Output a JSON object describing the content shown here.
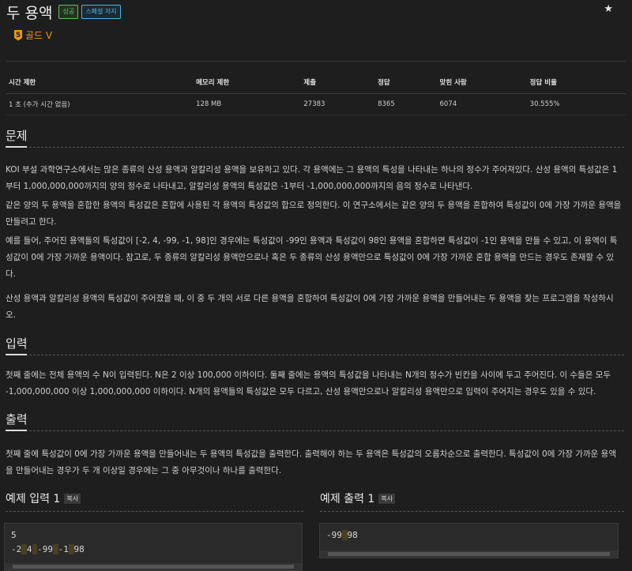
{
  "problem": {
    "title": "두 용액",
    "badges": {
      "success": "성공",
      "special": "스페셜 저지"
    },
    "tier": {
      "number": "5",
      "label": "골드 V",
      "color": "#ec9a00"
    }
  },
  "stats": {
    "headers": [
      "시간 제한",
      "메모리 제한",
      "제출",
      "정답",
      "맞힌 사람",
      "정답 비율"
    ],
    "values": [
      "1 초 (추가 시간 없음)",
      "128 MB",
      "27383",
      "8365",
      "6074",
      "30.555%"
    ]
  },
  "sections": {
    "problem_title": "문제",
    "problem_paragraphs": [
      "KOI 부설 과학연구소에서는 많은 종류의 산성 용액과 알칼리성 용액을 보유하고 있다. 각 용액에는 그 용액의 특성을 나타내는 하나의 정수가 주어져있다.  산성 용액의 특성값은 1부터 1,000,000,000까지의 양의 정수로 나타내고, 알칼리성 용액의 특성값은 -1부터 -1,000,000,000까지의 음의 정수로 나타낸다.",
      "같은 양의 두 용액을 혼합한 용액의 특성값은 혼합에 사용된 각 용액의 특성값의 합으로 정의한다. 이 연구소에서는 같은 양의 두 용액을 혼합하여 특성값이 0에 가장 가까운 용액을 만들려고 한다.",
      "예를 들어, 주어진 용액들의 특성값이 [-2, 4, -99, -1, 98]인 경우에는 특성값이 -99인 용액과 특성값이 98인 용액을 혼합하면 특성값이 -1인 용액을 만들 수 있고, 이 용액이 특성값이 0에 가장 가까운 용액이다. 참고로, 두 종류의 알칼리성 용액만으로나 혹은 두 종류의 산성 용액만으로 특성값이 0에 가장 가까운 혼합 용액을 만드는 경우도 존재할 수 있다.",
      "산성 용액과 알칼리성 용액의 특성값이 주어졌을 때, 이 중 두 개의 서로 다른 용액을 혼합하여 특성값이 0에 가장 가까운 용액을 만들어내는 두 용액을 찾는 프로그램을 작성하시오."
    ],
    "input_title": "입력",
    "input_paragraph": "첫째 줄에는 전체 용액의 수 N이 입력된다. N은 2 이상 100,000 이하이다. 둘째 줄에는 용액의 특성값을 나타내는 N개의 정수가 빈칸을 사이에 두고 주어진다. 이 수들은 모두 -1,000,000,000 이상 1,000,000,000 이하이다. N개의 용액들의 특성값은 모두 다르고, 산성 용액만으로나 알칼리성 용액만으로 입력이 주어지는 경우도 있을 수 있다.",
    "output_title": "출력",
    "output_paragraph": "첫째 줄에 특성값이 0에 가장 가까운 용액을 만들어내는 두 용액의 특성값을 출력한다. 출력해야 하는 두 용액은 특성값의 오름차순으로 출력한다. 특성값이 0에 가장 가까운 용액을 만들어내는 경우가 두 개 이상일 경우에는 그 중 아무것이나 하나를 출력한다."
  },
  "samples": {
    "input_title": "예제 입력 1",
    "output_title": "예제 출력 1",
    "copy_label": "복사",
    "input_line1": "5",
    "input_tokens": [
      "-2",
      "4",
      "-99",
      "-1",
      "98"
    ],
    "output_tokens": [
      "-99",
      "98"
    ]
  }
}
